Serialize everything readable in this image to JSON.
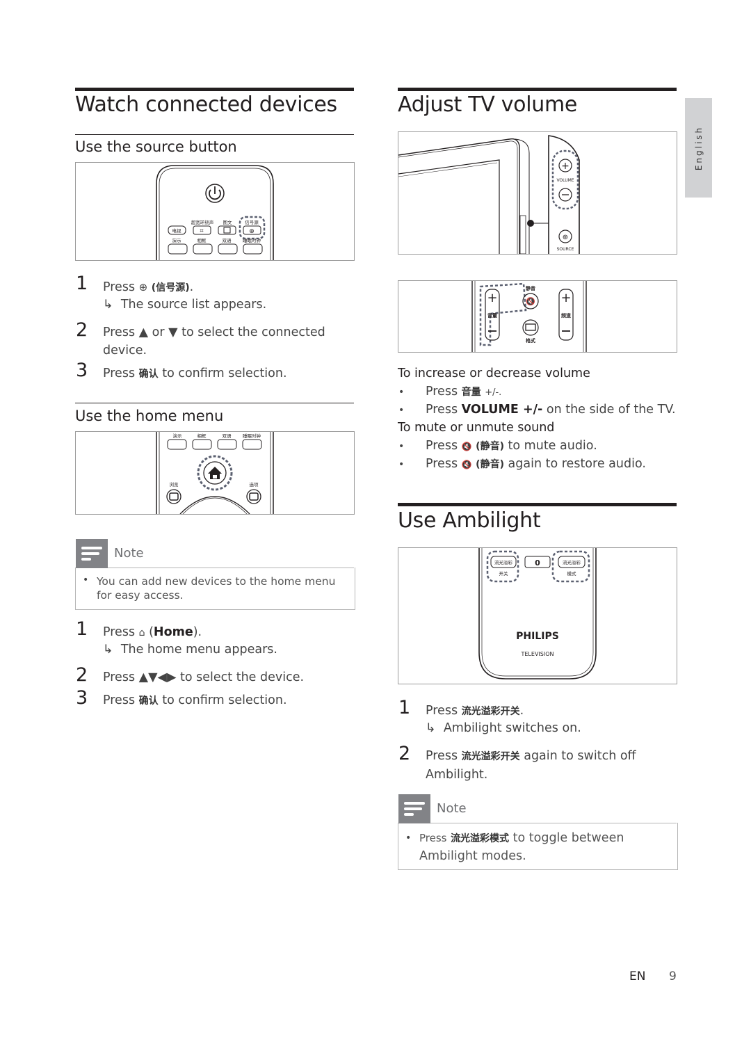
{
  "left": {
    "title": "Watch connected devices",
    "source_section": {
      "heading": "Use the source button",
      "figure": {
        "labels_row1": [
          "超宽环绕声",
          "图文",
          "信号源"
        ],
        "labels_row2": [
          "电视"
        ],
        "labels_row3": [
          "演示",
          "相框",
          "双语",
          "睡眠时钟"
        ]
      },
      "steps": [
        {
          "num": "1",
          "pre": "Press",
          "icon": "source-icon",
          "cjk": "(信号源)",
          "post": ".",
          "result": "The source list appears."
        },
        {
          "num": "2",
          "text": "Press ▲ or ▼ to select the connected",
          "text2": "device."
        },
        {
          "num": "3",
          "pre": "Press",
          "cjk": "确认",
          "post": "to confirm selection."
        }
      ]
    },
    "home_section": {
      "heading": "Use the home menu",
      "figure": {
        "labels_top": [
          "演示",
          "相框",
          "双语",
          "睡眠时钟"
        ],
        "label_left": "浏览",
        "label_right": "选项"
      },
      "note": {
        "label": "Note",
        "text_line1": "You can add new devices to the home menu",
        "text_line2": "for easy access."
      },
      "steps": [
        {
          "num": "1",
          "pre": "Press",
          "icon": "home-icon",
          "bold": "Home",
          "result": "The home menu appears."
        },
        {
          "num": "2",
          "text": "Press ▲▼◀▶ to select the device."
        },
        {
          "num": "3",
          "pre": "Press",
          "cjk": "确认",
          "post": "to confirm selection."
        }
      ]
    }
  },
  "right": {
    "volume_section": {
      "title": "Adjust TV volume",
      "figure_tv": {
        "volume_label": "VOLUME",
        "source_label": "SOURCE"
      },
      "figure_remote": {
        "mute_label": "静音",
        "vol_label": "音量",
        "ch_label": "频道",
        "format_label": "格式"
      },
      "increase_heading": "To increase or decrease volume",
      "increase_bullets": [
        {
          "pre": "Press",
          "cjk": "音量",
          "post": "+/-."
        },
        {
          "pre": "Press",
          "bold": "VOLUME +/-",
          "post": "on the side of the TV."
        }
      ],
      "mute_heading": "To mute or unmute sound",
      "mute_bullets": [
        {
          "pre": "Press",
          "icon": "mute-icon",
          "cjk": "(静音)",
          "post": "to mute audio."
        },
        {
          "pre": "Press",
          "icon": "mute-icon",
          "cjk": "(静音)",
          "post": "again to restore audio."
        }
      ]
    },
    "ambilight_section": {
      "title": "Use Ambilight",
      "figure": {
        "btn_left": "流光溢彩",
        "btn_left_sub": "开关",
        "btn_mid": "0",
        "btn_right": "流光溢彩",
        "btn_right_sub": "模式",
        "brand": "PHILIPS",
        "brand_sub": "TELEVISION"
      },
      "steps": [
        {
          "num": "1",
          "pre": "Press",
          "cjk": "流光溢彩开关",
          "post": ".",
          "result": "Ambilight switches on."
        },
        {
          "num": "2",
          "pre": "Press",
          "cjk": "流光溢彩开关",
          "post": "again to switch off",
          "text2": "Ambilight."
        }
      ],
      "note": {
        "label": "Note",
        "pre": "Press",
        "cjk": "流光溢彩模式",
        "post": "to toggle between",
        "text_line2": "Ambilight modes."
      }
    }
  },
  "side_tab": {
    "language": "English"
  },
  "footer": {
    "lang": "EN",
    "page": "9"
  },
  "symbols": {
    "bullet": "•",
    "result_arrow": "↳"
  }
}
